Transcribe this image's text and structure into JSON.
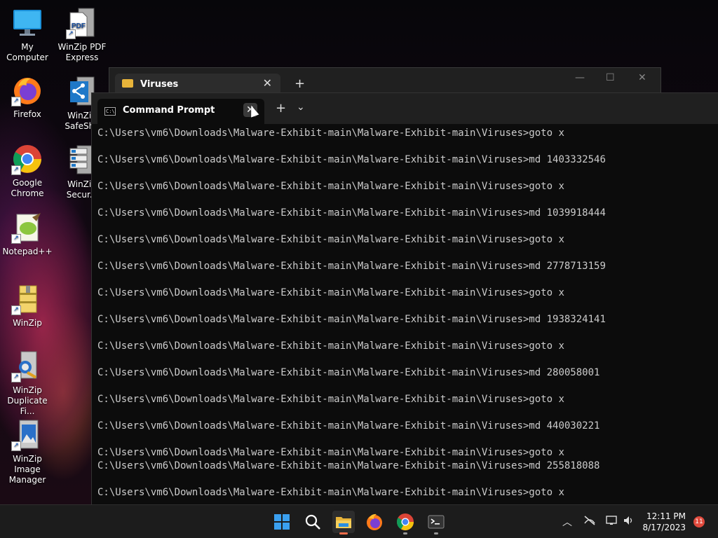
{
  "desktop": {
    "icons": [
      {
        "label": "My Computer"
      },
      {
        "label": "WinZip PDF Express"
      },
      {
        "label": "Firefox"
      },
      {
        "label": "WinZip SafeSha"
      },
      {
        "label": "Google Chrome"
      },
      {
        "label": "WinZip Secur..."
      },
      {
        "label": "Notepad++"
      },
      {
        "label": "WinZip"
      },
      {
        "label": "WinZip Duplicate Fi..."
      },
      {
        "label": "WinZip Image Manager"
      }
    ]
  },
  "explorer": {
    "tab_title": "Viruses",
    "close_glyph": "✕",
    "add_glyph": "+"
  },
  "terminal": {
    "tab_title": "Command Prompt",
    "cmd_icon_text": "C:\\",
    "close_glyph": "✕",
    "add_glyph": "+",
    "dropdown_glyph": "⌄",
    "lines": [
      "C:\\Users\\vm6\\Downloads\\Malware-Exhibit-main\\Malware-Exhibit-main\\Viruses>goto x",
      "C:\\Users\\vm6\\Downloads\\Malware-Exhibit-main\\Malware-Exhibit-main\\Viruses>md 1403332546",
      "C:\\Users\\vm6\\Downloads\\Malware-Exhibit-main\\Malware-Exhibit-main\\Viruses>goto x",
      "C:\\Users\\vm6\\Downloads\\Malware-Exhibit-main\\Malware-Exhibit-main\\Viruses>md 1039918444",
      "C:\\Users\\vm6\\Downloads\\Malware-Exhibit-main\\Malware-Exhibit-main\\Viruses>goto x",
      "C:\\Users\\vm6\\Downloads\\Malware-Exhibit-main\\Malware-Exhibit-main\\Viruses>md 2778713159",
      "C:\\Users\\vm6\\Downloads\\Malware-Exhibit-main\\Malware-Exhibit-main\\Viruses>goto x",
      "C:\\Users\\vm6\\Downloads\\Malware-Exhibit-main\\Malware-Exhibit-main\\Viruses>md 1938324141",
      "C:\\Users\\vm6\\Downloads\\Malware-Exhibit-main\\Malware-Exhibit-main\\Viruses>goto x",
      "C:\\Users\\vm6\\Downloads\\Malware-Exhibit-main\\Malware-Exhibit-main\\Viruses>md 280058001",
      "C:\\Users\\vm6\\Downloads\\Malware-Exhibit-main\\Malware-Exhibit-main\\Viruses>goto x",
      "C:\\Users\\vm6\\Downloads\\Malware-Exhibit-main\\Malware-Exhibit-main\\Viruses>md 440030221",
      "C:\\Users\\vm6\\Downloads\\Malware-Exhibit-main\\Malware-Exhibit-main\\Viruses>goto x",
      "C:\\Users\\vm6\\Downloads\\Malware-Exhibit-main\\Malware-Exhibit-main\\Viruses>md 255818088",
      "C:\\Users\\vm6\\Downloads\\Malware-Exhibit-main\\Malware-Exhibit-main\\Viruses>goto x"
    ]
  },
  "taskbar": {
    "clock_time": "12:11 PM",
    "clock_date": "8/17/2023",
    "notification_count": "11",
    "tray_chevron": "︿"
  },
  "colors": {
    "terminal_bg": "#0c0c0c",
    "terminal_text": "#cccccc",
    "accent": "#f56e4b"
  }
}
